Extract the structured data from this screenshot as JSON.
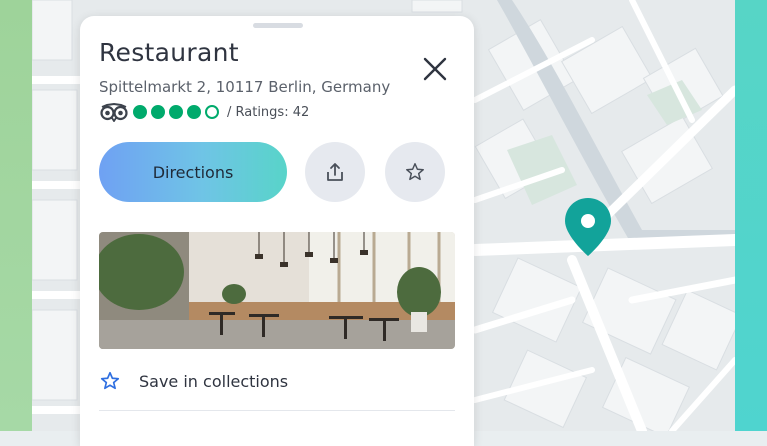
{
  "place": {
    "name": "Restaurant",
    "address": "Spittelmarkt 2, 10117 Berlin, Germany",
    "rating_filled": 4,
    "rating_max": 5,
    "ratings_text": "/ Ratings: 42"
  },
  "actions": {
    "directions_label": "Directions",
    "save_label": "Save in collections"
  },
  "icons": {
    "close": "close-icon",
    "share": "share-icon",
    "favorite": "star-icon",
    "tripadvisor": "tripadvisor-owl-icon",
    "pin": "map-pin-icon"
  },
  "colors": {
    "rating_green": "#00aa6c",
    "pin_teal": "#12a39a",
    "save_star_blue": "#2f6fe0"
  }
}
